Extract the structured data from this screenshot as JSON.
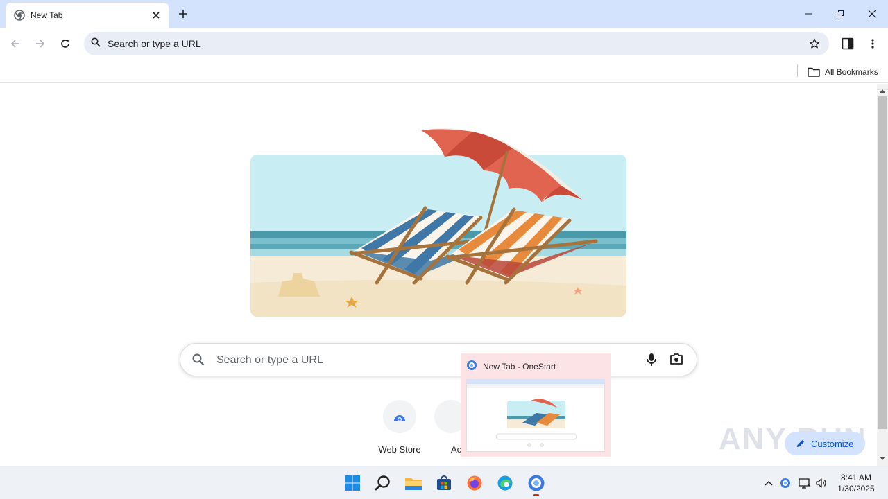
{
  "browser": {
    "tab": {
      "title": "New Tab"
    },
    "omnibox": {
      "text": "Search or type a URL"
    },
    "bookmarks": {
      "all_bookmarks_label": "All Bookmarks"
    }
  },
  "ntp": {
    "search": {
      "placeholder": "Search or type a URL"
    },
    "shortcuts": [
      {
        "label": "Web Store"
      },
      {
        "label": "Ac"
      }
    ],
    "customize_label": "Customize",
    "watermark": "ANY RUN"
  },
  "taskbar": {
    "preview": {
      "title": "New Tab - OneStart"
    },
    "clock": {
      "time": "8:41 AM",
      "date": "1/30/2025"
    }
  },
  "colors": {
    "accent": "#0b57d0",
    "tabstrip": "#d3e3fd",
    "omnibox": "#e9eef6",
    "preview_bg": "#fbe3e6"
  }
}
